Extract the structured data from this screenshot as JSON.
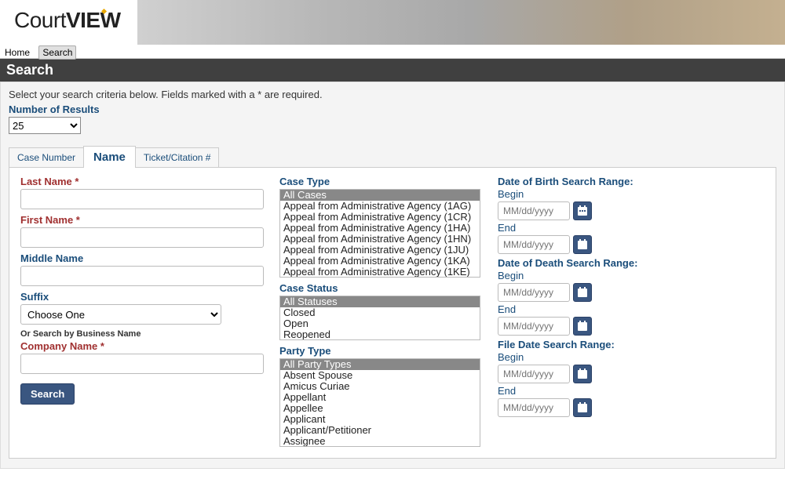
{
  "logo": {
    "part1": "Court",
    "part2": "VIEW"
  },
  "nav": {
    "home": "Home",
    "search": "Search"
  },
  "page_title": "Search",
  "instructions": "Select your search criteria below. Fields marked with a * are required.",
  "results": {
    "label": "Number of Results",
    "value": "25"
  },
  "tabs": {
    "case_number": "Case Number",
    "name": "Name",
    "ticket": "Ticket/Citation #"
  },
  "fields": {
    "last_name": "Last Name *",
    "first_name": "First Name *",
    "middle_name": "Middle Name",
    "suffix": "Suffix",
    "suffix_value": "Choose One",
    "business_sub": "Or Search by Business Name",
    "company_name": "Company Name *",
    "case_type": "Case Type",
    "case_status": "Case Status",
    "party_type": "Party Type"
  },
  "case_types": [
    "All Cases",
    "Appeal from Administrative Agency (1AG)",
    "Appeal from Administrative Agency (1CR)",
    "Appeal from Administrative Agency (1HA)",
    "Appeal from Administrative Agency (1HN)",
    "Appeal from Administrative Agency (1JU)",
    "Appeal from Administrative Agency (1KA)",
    "Appeal from Administrative Agency (1KE)"
  ],
  "case_statuses": [
    "All Statuses",
    "Closed",
    "Open",
    "Reopened"
  ],
  "party_types": [
    "All Party Types",
    "Absent Spouse",
    "Amicus Curiae",
    "Appellant",
    "Appellee",
    "Applicant",
    "Applicant/Petitioner",
    "Assignee"
  ],
  "dates": {
    "dob_label": "Date of Birth Search Range:",
    "dod_label": "Date of Death Search Range:",
    "file_label": "File Date Search Range:",
    "begin": "Begin",
    "end": "End",
    "placeholder": "MM/dd/yyyy"
  },
  "search_btn": "Search"
}
